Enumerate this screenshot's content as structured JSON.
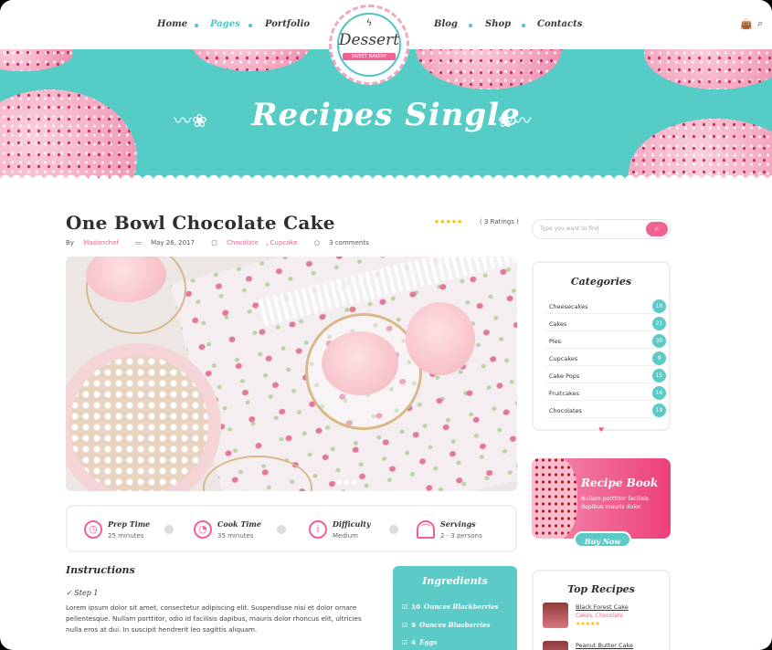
{
  "nav": {
    "left": [
      "Home",
      "Pages",
      "Portfolio"
    ],
    "right": [
      "Blog",
      "Shop",
      "Contacts"
    ],
    "active": "Pages"
  },
  "logo": {
    "brand": "Dessert",
    "tagline": "SWEET BAKERY"
  },
  "hero": {
    "title": "Recipes Single"
  },
  "post": {
    "title": "One Bowl Chocolate Cake",
    "stars": "★★★★★",
    "ratings": "( 3 Ratings )",
    "by": "By",
    "author": "Masterchef",
    "date": "May 26, 2017",
    "cat1": "Chocolate",
    "cat2": "Cupcake",
    "comments": "3 comments"
  },
  "info": [
    {
      "label": "Prep Time",
      "value": "25 minutes",
      "icon": "clock-icon"
    },
    {
      "label": "Cook Time",
      "value": "35 minutes",
      "icon": "timer-icon"
    },
    {
      "label": "Difficulty",
      "value": "Medium",
      "icon": "info-icon"
    },
    {
      "label": "Servings",
      "value": "2 - 3 persons",
      "icon": "cloche-icon"
    }
  ],
  "instructions": {
    "heading": "Instructions",
    "step": "Step 1",
    "text": "Lorem ipsum dolor sit amet, consectetur adipiscing elit. Suspendisse nisi et dolor ornare pellentesque. Nullam porttitor, odio id facilisis dapibus, mauris dolor rhoncus elit, ultricies nulla eros at dui. In suscipit hendrerit leo sagittis aliquam."
  },
  "ingredients": {
    "heading": "Ingredients",
    "items": [
      {
        "qty": "10",
        "unit": "Ounces",
        "name": "Blackberries"
      },
      {
        "qty": "6",
        "unit": "Ounces",
        "name": "Blueberries"
      },
      {
        "qty": "4",
        "unit": "",
        "name": "Eggs"
      }
    ]
  },
  "sidebar": {
    "search_placeholder": "Type you want to find",
    "categories_heading": "Categories",
    "categories": [
      {
        "name": "Cheesecakes",
        "count": "10"
      },
      {
        "name": "Cakes",
        "count": "21"
      },
      {
        "name": "Pies",
        "count": "30"
      },
      {
        "name": "Cupcakes",
        "count": "9"
      },
      {
        "name": "Cake Pops",
        "count": "15"
      },
      {
        "name": "Fruitcakes",
        "count": "16"
      },
      {
        "name": "Chocolates",
        "count": "19"
      }
    ],
    "book_title": "Recipe Book",
    "book_text": "Nullam porttitor facilisis dapibus mauris dolor.",
    "buy_label": "Buy Now",
    "top_heading": "Top Recipes",
    "top": [
      {
        "name": "Black Forest Cake",
        "cats": "Cakes, Chocolate",
        "stars": "★★★★★"
      },
      {
        "name": "Peanut Butter Cake",
        "cats": "",
        "stars": ""
      }
    ]
  },
  "colors": {
    "accent": "#5ccac6",
    "pink": "#f06292",
    "star": "#f5b800"
  }
}
